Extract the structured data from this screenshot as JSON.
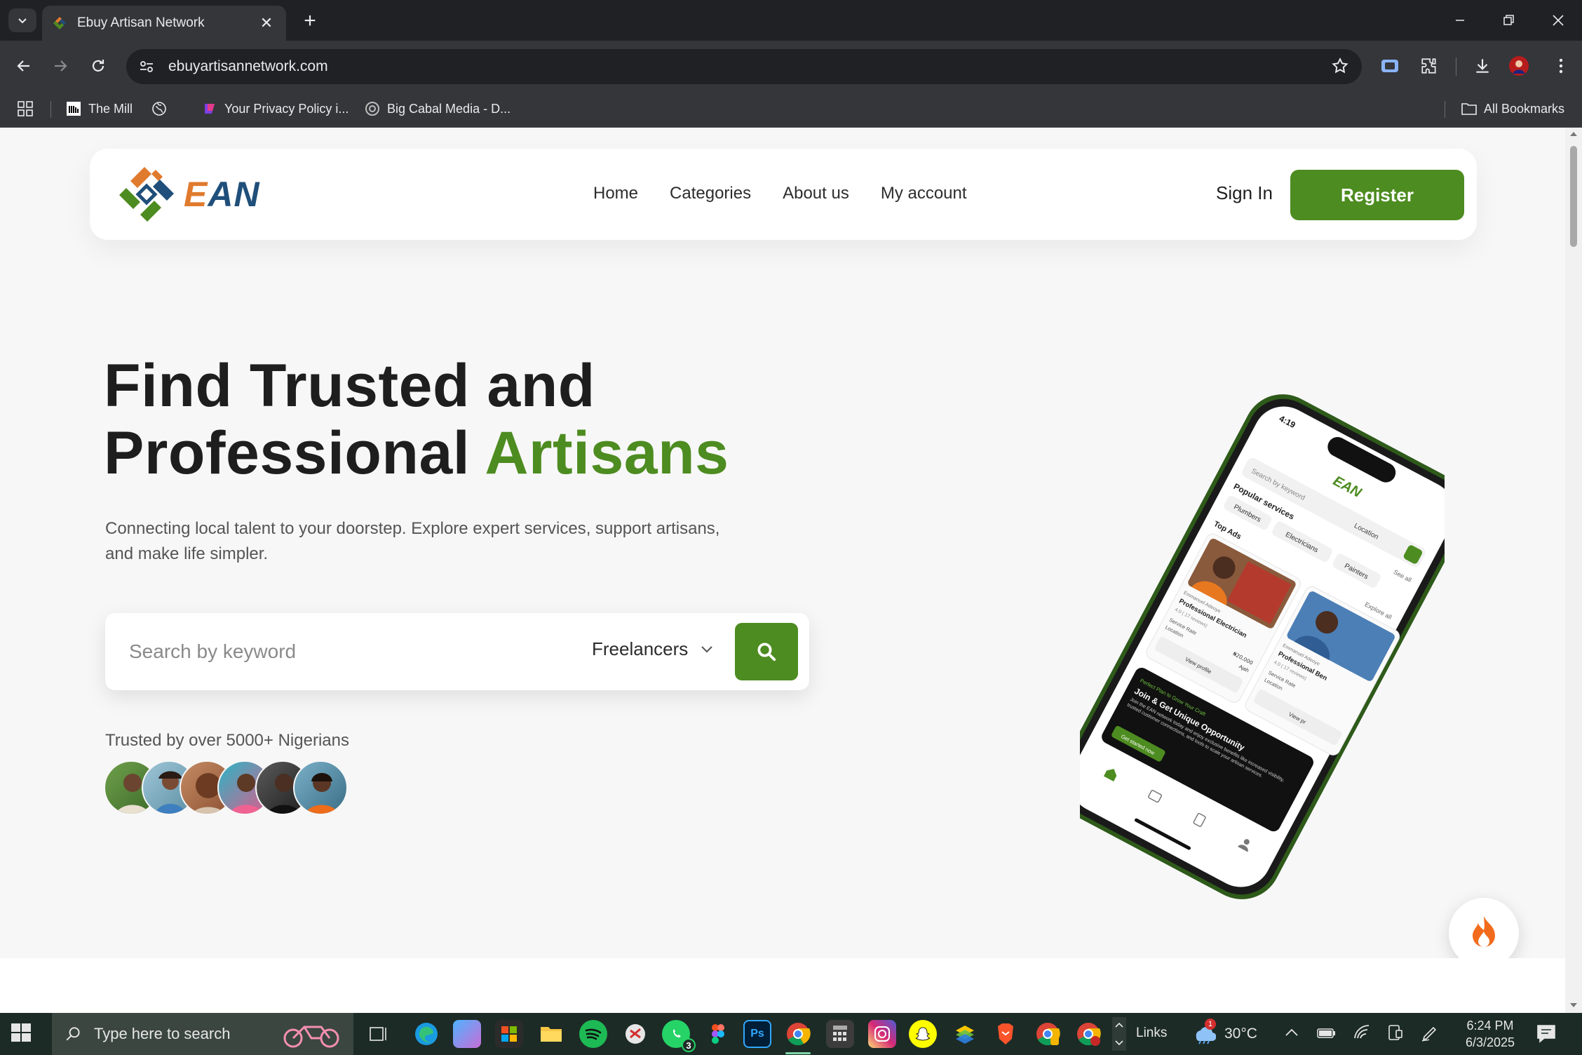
{
  "browser": {
    "tab_title": "Ebuy Artisan Network",
    "url": "ebuyartisannetwork.com",
    "bookmarks": [
      {
        "label": "The Mill"
      },
      {
        "label": ""
      },
      {
        "label": "Your Privacy Policy i..."
      },
      {
        "label": "Big Cabal Media - D..."
      }
    ],
    "all_bookmarks": "All Bookmarks"
  },
  "header": {
    "logo_text": "EAN",
    "nav": [
      "Home",
      "Categories",
      "About us",
      "My account"
    ],
    "signin": "Sign In",
    "register": "Register"
  },
  "hero": {
    "title_line1": "Find Trusted and",
    "title_line2_prefix": "Professional ",
    "title_line2_highlight": "Artisans",
    "subtitle": "Connecting local talent to your doorstep. Explore expert services, support artisans, and make life simpler.",
    "search_placeholder": "Search by keyword",
    "search_category": "Freelancers",
    "trusted_text": "Trusted by over 5000+ Nigerians"
  },
  "phone_mock": {
    "time": "4:19",
    "logo": "EAN",
    "search_placeholder": "Search by keyword",
    "location": "Location",
    "popular": "Popular services",
    "see_all": "See all",
    "chips": [
      "Plumbers",
      "Electricians",
      "Painters"
    ],
    "top_ads": "Top Ads",
    "explore_all": "Explore all",
    "card1": {
      "name": "Emmanuel Adeoye",
      "title": "Professional Electrician",
      "rating": "4.0 ( 17 reviews)",
      "rate_label": "Service Rate",
      "rate": "₦20,000",
      "loc_label": "Location",
      "loc": "Ajah",
      "cta": "View profile"
    },
    "card2": {
      "name": "Emmanuel Adeoye",
      "title": "Professional Ben",
      "rating": "4.0 ( 17 reviews)",
      "rate_label": "Service Rate",
      "loc_label": "Location",
      "cta": "View pr"
    },
    "banner_kicker": "Perfect Plan to Grow Your Craft",
    "banner_title": "Join & Get Unique Opportunity",
    "banner_body": "Join the EAN network today and enjoy exclusive benefits like increased visibility, trusted customer connections, and tools to scale your artisan services.",
    "banner_cta": "Get started now"
  },
  "taskbar": {
    "search_placeholder": "Type here to search",
    "links": "Links",
    "temperature": "30°C",
    "time": "6:24 PM",
    "date": "6/3/2025",
    "whatsapp_badge": "3",
    "weather_badge": "1"
  },
  "colors": {
    "brand_green": "#4d8c20",
    "brand_orange": "#e07a2e",
    "logo_navy": "#1f4f7a"
  }
}
